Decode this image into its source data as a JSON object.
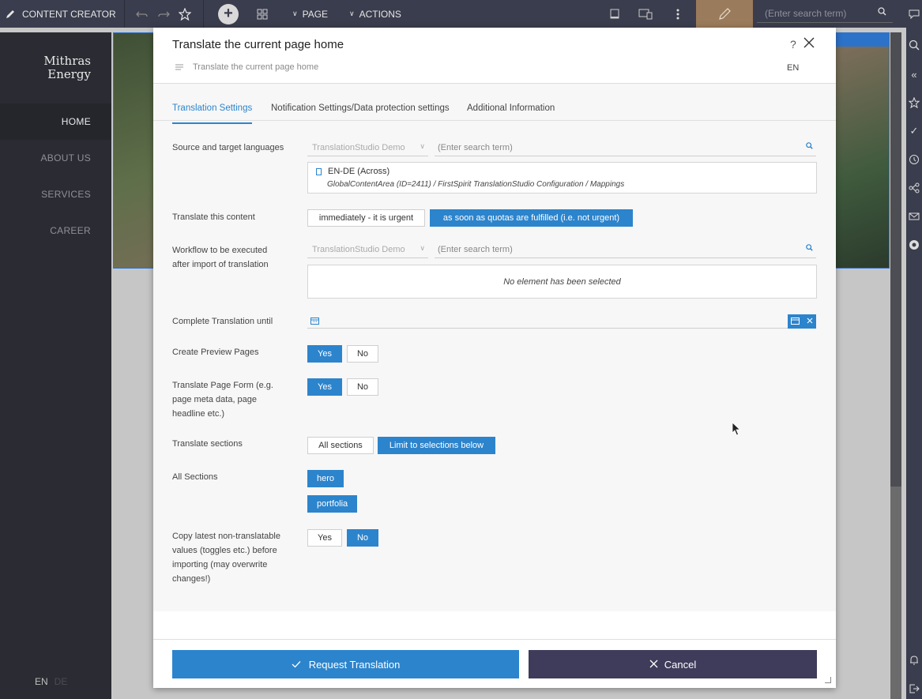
{
  "topbar": {
    "app_name": "CONTENT CREATOR",
    "page_menu": "PAGE",
    "actions_menu": "ACTIONS",
    "search_placeholder": "(Enter search term)"
  },
  "site": {
    "logo_line1": "Mithras",
    "logo_line2": "Energy",
    "nav": [
      "HOME",
      "ABOUT US",
      "SERVICES",
      "CAREER"
    ],
    "lang_active": "EN",
    "lang_inactive": "DE"
  },
  "dialog": {
    "title": "Translate the current page home",
    "subtitle": "Translate the current page home",
    "language": "EN",
    "help": "?",
    "tabs": [
      "Translation Settings",
      "Notification Settings/Data protection settings",
      "Additional Information"
    ],
    "source_target": {
      "label": "Source and target languages",
      "select_value": "TranslationStudio Demo",
      "search_placeholder": "(Enter search term)",
      "entry_title": "EN-DE (Across)",
      "entry_path": "GlobalContentArea (ID=2411) / FirstSpirit TranslationStudio Configuration / Mappings"
    },
    "translate_content": {
      "label": "Translate this content",
      "option_urgent": "immediately - it is urgent",
      "option_not_urgent": "as soon as quotas are fulfilled (i.e. not urgent)"
    },
    "workflow": {
      "label_line1": "Workflow to be executed",
      "label_line2": "after import of translation",
      "select_value": "TranslationStudio Demo",
      "search_placeholder": "(Enter search term)",
      "empty_message": "No element has been selected"
    },
    "complete_until": {
      "label": "Complete Translation until"
    },
    "preview_pages": {
      "label": "Create Preview Pages",
      "yes": "Yes",
      "no": "No"
    },
    "page_form": {
      "label_line1": "Translate Page Form (e.g.",
      "label_line2": "page meta data, page",
      "label_line3": "headline etc.)",
      "yes": "Yes",
      "no": "No"
    },
    "sections": {
      "label": "Translate sections",
      "all": "All sections",
      "limit": "Limit to selections below"
    },
    "all_sections": {
      "label": "All Sections",
      "items": [
        "hero",
        "portfolia"
      ]
    },
    "copy_values": {
      "label_line1": "Copy latest non-translatable",
      "label_line2": "values (toggles etc.) before",
      "label_line3": "importing (may overwrite",
      "label_line4": "changes!)",
      "yes": "Yes",
      "no": "No"
    },
    "request_button": "Request Translation",
    "cancel_button": "Cancel"
  },
  "colors": {
    "accent": "#2c84cc",
    "topbar": "#3a3d4d",
    "cancel": "#3e3c5a",
    "edit_mode": "#9a7b5b"
  }
}
